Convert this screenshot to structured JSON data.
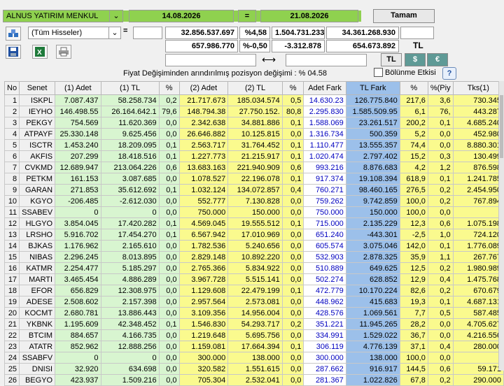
{
  "header": {
    "company": "ALNUS YATIRIM MENKUL",
    "date1": "14.08.2026",
    "eq": "=",
    "date2": "21.08.2026",
    "submit": "Tamam"
  },
  "filter": {
    "stock_select": "(Tüm Hisseler)",
    "eq": "="
  },
  "summary": {
    "row1": [
      "32.856.537.697",
      "%4,58",
      "1.504.731.233",
      "34.361.268.930"
    ],
    "row2": [
      "657.986.770",
      "%-0,50",
      "-3.312.878",
      "654.673.892"
    ],
    "currency_label": "TL",
    "arrow": "⟷",
    "cur_tl": "TL",
    "cur_usd": "$",
    "cur_eur": "€"
  },
  "info": {
    "text": "Fiyat Değişiminden arındırılmış pozisyon değişimi : % 04.58",
    "checkbox_label": "Bölünme Etkisi",
    "help": "?"
  },
  "table": {
    "columns": [
      "No",
      "Senet",
      "(1) Adet",
      "(1) TL",
      "%",
      "(2) Adet",
      "(2) TL",
      "%",
      "Adet Fark",
      "TL Fark",
      "%",
      "%(Piy",
      "Tks(1)"
    ],
    "rows": [
      [
        "1",
        "ISKPL",
        "7.087.437",
        "58.258.734",
        "0,2",
        "21.717.673",
        "185.034.574",
        "0,5",
        "14.630.23",
        "126.775.840",
        "217,6",
        "3,6",
        "730.345"
      ],
      [
        "2",
        "IEYHO",
        "146.498.55",
        "26.164.642.1",
        "79,6",
        "148.794.38",
        "27.750.152.",
        "80,8",
        "2.295.830",
        "1.585.509.95",
        "6,1",
        "76,",
        "443.287"
      ],
      [
        "3",
        "PEKGY",
        "754.569",
        "11.620.369",
        "0,0",
        "2.342.638",
        "34.881.886",
        "0,1",
        "1.588.069",
        "23.261.517",
        "200,2",
        "0,1",
        "4.685.240"
      ],
      [
        "4",
        "ATPAYF",
        "25.330.148",
        "9.625.456",
        "0,0",
        "26.646.882",
        "10.125.815",
        "0,0",
        "1.316.734",
        "500.359",
        "5,2",
        "0,0",
        "452.980"
      ],
      [
        "5",
        "ISCTR",
        "1.453.240",
        "18.209.095",
        "0,1",
        "2.563.717",
        "31.764.452",
        "0,1",
        "1.110.477",
        "13.555.357",
        "74,4",
        "0,0",
        "8.880.301"
      ],
      [
        "6",
        "AKFIS",
        "207.299",
        "18.418.516",
        "0,1",
        "1.227.773",
        "21.215.917",
        "0,1",
        "1.020.474",
        "2.797.402",
        "15,2",
        "0,3",
        "130.499"
      ],
      [
        "7",
        "CVKMD",
        "12.689.947",
        "213.064.226",
        "0,6",
        "13.683.163",
        "221.940.909",
        "0,6",
        "993.216",
        "8.876.683",
        "4,2",
        "1,2",
        "876.598"
      ],
      [
        "8",
        "PETKM",
        "161.153",
        "3.087.685",
        "0,0",
        "1.078.527",
        "22.196.078",
        "0,1",
        "917.374",
        "19.108.394",
        "618,9",
        "0,1",
        "1.241.785"
      ],
      [
        "9",
        "GARAN",
        "271.853",
        "35.612.692",
        "0,1",
        "1.032.124",
        "134.072.857",
        "0,4",
        "760.271",
        "98.460.165",
        "276,5",
        "0,2",
        "2.454.950"
      ],
      [
        "10",
        "KGYO",
        "-206.485",
        "-2.612.030",
        "0,0",
        "552.777",
        "7.130.828",
        "0,0",
        "759.262",
        "9.742.859",
        "100,0",
        "0,2",
        "767.894"
      ],
      [
        "11",
        "SSABEV",
        "0",
        "0",
        "0,0",
        "750.000",
        "150.000",
        "0,0",
        "750.000",
        "150.000",
        "100,0",
        "0,0",
        ""
      ],
      [
        "12",
        "HLGYO",
        "3.854.045",
        "17.420.282",
        "0,1",
        "4.569.045",
        "19.555.512",
        "0,1",
        "715.000",
        "2.135.229",
        "12,3",
        "0,6",
        "1.075.198"
      ],
      [
        "13",
        "LRSHO",
        "5.916.702",
        "17.454.270",
        "0,1",
        "6.567.942",
        "17.010.969",
        "0,0",
        "651.240",
        "-443.301",
        "-2,5",
        "1,0",
        "724.120"
      ],
      [
        "14",
        "BJKAS",
        "1.176.962",
        "2.165.610",
        "0,0",
        "1.782.536",
        "5.240.656",
        "0,0",
        "605.574",
        "3.075.046",
        "142,0",
        "0,1",
        "1.776.089"
      ],
      [
        "15",
        "NIBAS",
        "2.296.245",
        "8.013.895",
        "0,0",
        "2.829.148",
        "10.892.220",
        "0,0",
        "532.903",
        "2.878.325",
        "35,9",
        "1,1",
        "267.767"
      ],
      [
        "16",
        "KATMR",
        "2.254.477",
        "5.185.297",
        "0,0",
        "2.765.366",
        "5.834.922",
        "0,0",
        "510.889",
        "649.625",
        "12,5",
        "0,2",
        "1.980.989"
      ],
      [
        "17",
        "MARTI",
        "3.465.454",
        "4.886.289",
        "0,0",
        "3.967.728",
        "5.515.141",
        "0,0",
        "502.274",
        "628.852",
        "12,9",
        "0,4",
        "1.475.768"
      ],
      [
        "18",
        "EFOR",
        "656.829",
        "12.308.975",
        "0,0",
        "1.129.608",
        "22.479.199",
        "0,1",
        "472.779",
        "10.170.224",
        "82,6",
        "0,2",
        "670.679"
      ],
      [
        "19",
        "ADESE",
        "2.508.602",
        "2.157.398",
        "0,0",
        "2.957.564",
        "2.573.081",
        "0,0",
        "448.962",
        "415.683",
        "19,3",
        "0,1",
        "4.687.131"
      ],
      [
        "20",
        "KOCMT",
        "2.680.781",
        "13.886.443",
        "0,0",
        "3.109.356",
        "14.956.004",
        "0,0",
        "428.576",
        "1.069.561",
        "7,7",
        "0,5",
        "587.485"
      ],
      [
        "21",
        "YKBNK",
        "1.195.609",
        "42.348.452",
        "0,1",
        "1.546.830",
        "54.293.717",
        "0,2",
        "351.221",
        "11.945.265",
        "28,2",
        "0,0",
        "4.705.627"
      ],
      [
        "22",
        "BTCIM",
        "884.657",
        "4.166.735",
        "0,0",
        "1.219.648",
        "5.695.756",
        "0,0",
        "334.991",
        "1.529.022",
        "36,7",
        "0,0",
        "4.216.556"
      ],
      [
        "23",
        "ATATR",
        "852.962",
        "12.888.256",
        "0,0",
        "1.159.081",
        "17.664.394",
        "0,1",
        "306.119",
        "4.776.139",
        "37,1",
        "0,4",
        "280.000"
      ],
      [
        "24",
        "SSABFV",
        "0",
        "0",
        "0,0",
        "300.000",
        "138.000",
        "0,0",
        "300.000",
        "138.000",
        "100,0",
        "0,0",
        ""
      ],
      [
        "25",
        "DNISI",
        "32.920",
        "634.698",
        "0,0",
        "320.582",
        "1.551.615",
        "0,0",
        "287.662",
        "916.917",
        "144,5",
        "0,6",
        "59.171"
      ],
      [
        "26",
        "BEGYO",
        "423.937",
        "1.509.216",
        "0,0",
        "705.304",
        "2.532.041",
        "0,0",
        "281.367",
        "1.022.826",
        "67,8",
        "0,2",
        "290.000"
      ]
    ]
  }
}
